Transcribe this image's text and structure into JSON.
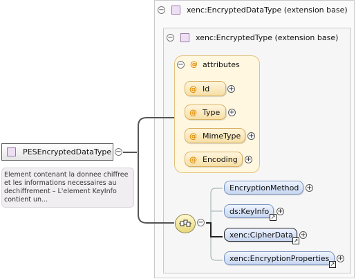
{
  "root": {
    "name": "PESEncryptedDataType",
    "documentation": "Element contenant la donnee chiffree et les informations necessaires au dechiffrement – L'element KeyInfo contient un..."
  },
  "outer_frame": {
    "title": "xenc:EncryptedDataType (extension base)"
  },
  "inner_frame": {
    "title": "xenc:EncryptedType (extension base)"
  },
  "attributes": {
    "group_label": "attributes",
    "items": [
      {
        "name": "Id"
      },
      {
        "name": "Type"
      },
      {
        "name": "MimeType"
      },
      {
        "name": "Encoding"
      }
    ]
  },
  "sequence": {
    "elements": [
      {
        "name": "EncryptionMethod",
        "required": false,
        "reference": false
      },
      {
        "name": "ds:KeyInfo",
        "required": false,
        "reference": true
      },
      {
        "name": "xenc:CipherData",
        "required": true,
        "reference": true
      },
      {
        "name": "xenc:EncryptionProperties",
        "required": false,
        "reference": true
      }
    ]
  },
  "glyphs": {
    "collapse": "⊖",
    "expand": "+",
    "at": "@",
    "link": "↗"
  }
}
